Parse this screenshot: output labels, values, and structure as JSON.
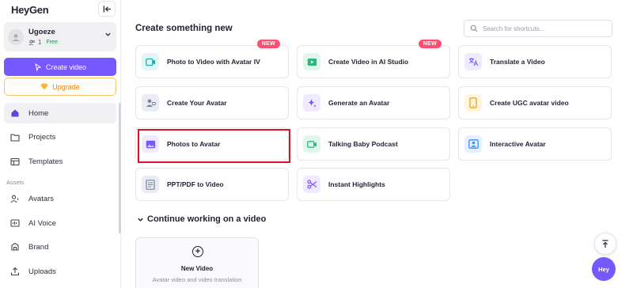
{
  "sidebar": {
    "logo": "HeyGen",
    "workspace": {
      "name": "Ugoeze",
      "members": "1",
      "plan": "Free"
    },
    "create_video_label": "Create video",
    "upgrade_label": "Upgrade",
    "nav": [
      {
        "label": "Home",
        "icon": "home-icon",
        "active": true
      },
      {
        "label": "Projects",
        "icon": "folder-icon"
      },
      {
        "label": "Templates",
        "icon": "templates-icon"
      }
    ],
    "assets_section": "Assets",
    "assets": [
      {
        "label": "Avatars",
        "icon": "avatar-icon"
      },
      {
        "label": "AI Voice",
        "icon": "voice-icon"
      },
      {
        "label": "Brand",
        "icon": "brand-icon"
      },
      {
        "label": "Uploads",
        "icon": "upload-icon"
      }
    ]
  },
  "main": {
    "section_title": "Create something new",
    "search_placeholder": "Search for shortcuts...",
    "badge_new": "NEW",
    "cards": [
      {
        "label": "Photo to Video with Avatar IV",
        "icon": "photo-video-icon",
        "color": "#e3f6f6"
      },
      {
        "label": "Create Video in AI Studio",
        "icon": "ai-studio-icon",
        "color": "#e3f6ee"
      },
      {
        "label": "Translate a Video",
        "icon": "translate-icon",
        "color": "#efeaff"
      },
      {
        "label": "Create Your Avatar",
        "icon": "create-avatar-icon",
        "color": "#eaecf5"
      },
      {
        "label": "Generate an Avatar",
        "icon": "sparkle-icon",
        "color": "#efeaff"
      },
      {
        "label": "Create UGC avatar video",
        "icon": "phone-icon",
        "color": "#fff4dc"
      },
      {
        "label": "Photos to Avatar",
        "icon": "image-icon",
        "color": "#efeaff"
      },
      {
        "label": "Talking Baby Podcast",
        "icon": "video-camera-icon",
        "color": "#e3f6ee"
      },
      {
        "label": "Interactive Avatar",
        "icon": "interactive-avatar-icon",
        "color": "#e3f0ff"
      },
      {
        "label": "PPT/PDF to Video",
        "icon": "document-icon",
        "color": "#eaecf5"
      },
      {
        "label": "Instant Highlights",
        "icon": "scissors-icon",
        "color": "#efeaff"
      }
    ],
    "continue_title": "Continue working on a video",
    "new_video_title": "New Video",
    "new_video_subtitle": "Avatar video and video translation",
    "hey_label": "Hey"
  },
  "colors": {
    "accent": "#7559ff",
    "upgrade": "#e08a00",
    "new_badge": "#ff4f6e",
    "highlight": "#d9122a"
  }
}
